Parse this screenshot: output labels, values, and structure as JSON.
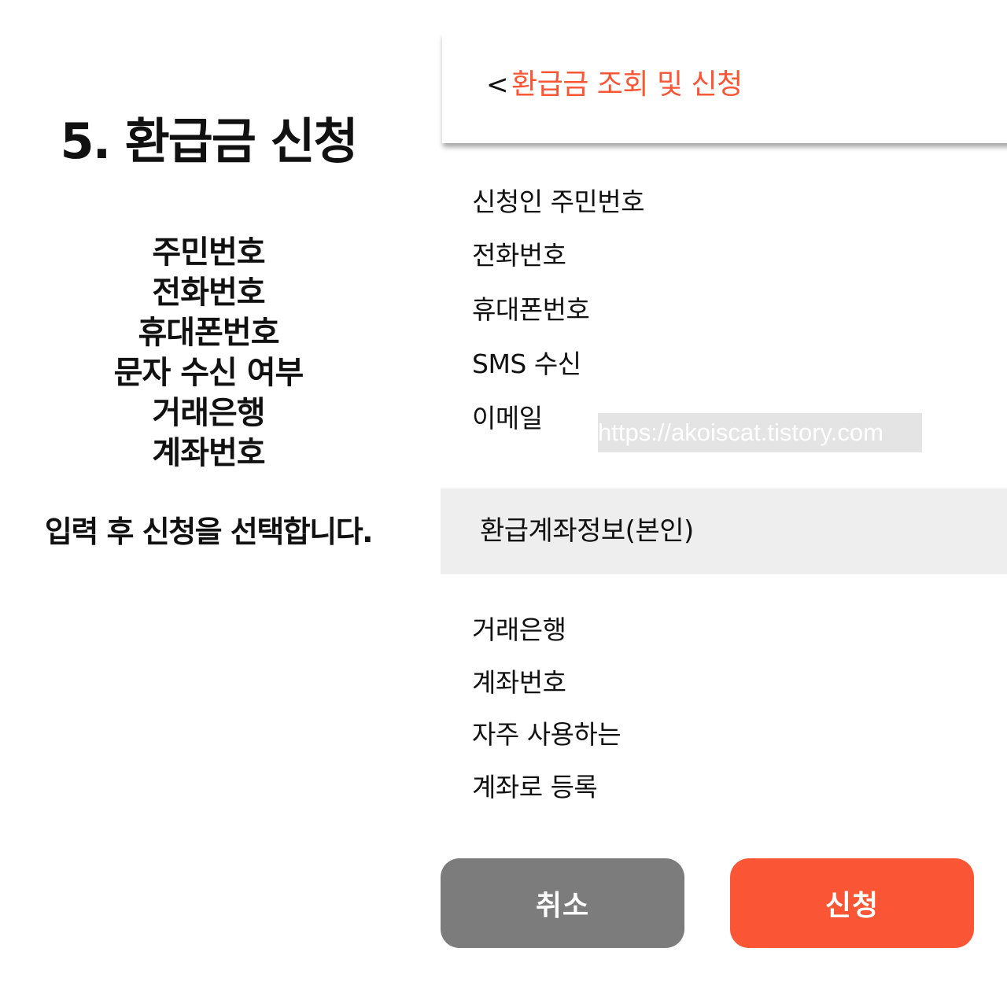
{
  "left_panel": {
    "title": "5. 환급금 신청",
    "items": [
      "주민번호",
      "전화번호",
      "휴대폰번호",
      "문자 수신 여부",
      "거래은행",
      "계좌번호"
    ],
    "footer": "입력 후 신청을 선택합니다."
  },
  "header": {
    "back_label": "<",
    "title": "환급금 조회 및 신청"
  },
  "applicant_fields": [
    "신청인 주민번호",
    "전화번호",
    "휴대폰번호",
    "SMS 수신",
    "이메일"
  ],
  "watermark": "https://akoiscat.tistory.com",
  "section": {
    "title": "환급계좌정보(본인)"
  },
  "account_fields": [
    "거래은행",
    "계좌번호",
    "자주 사용하는",
    "계좌로 등록"
  ],
  "buttons": {
    "cancel_label": "취소",
    "submit_label": "신청"
  },
  "colors": {
    "accent": "#fa5535",
    "cancel": "#7c7c7c",
    "section_bg": "#eeeeee"
  }
}
